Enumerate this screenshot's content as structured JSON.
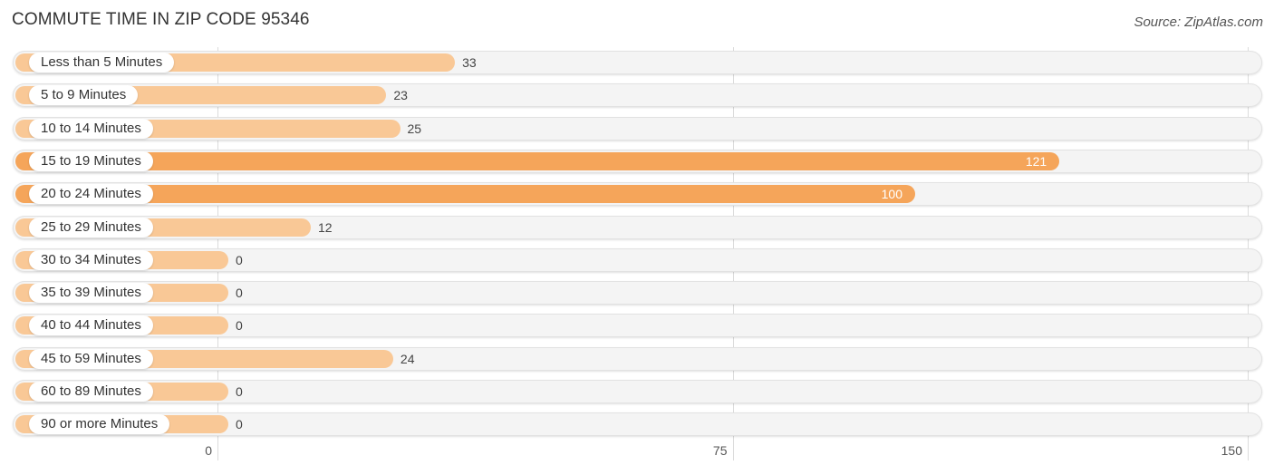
{
  "chart_data": {
    "type": "bar",
    "orientation": "horizontal",
    "title": "COMMUTE TIME IN ZIP CODE 95346",
    "source": "Source: ZipAtlas.com",
    "categories": [
      "Less than 5 Minutes",
      "5 to 9 Minutes",
      "10 to 14 Minutes",
      "15 to 19 Minutes",
      "20 to 24 Minutes",
      "25 to 29 Minutes",
      "30 to 34 Minutes",
      "35 to 39 Minutes",
      "40 to 44 Minutes",
      "45 to 59 Minutes",
      "60 to 89 Minutes",
      "90 or more Minutes"
    ],
    "values": [
      33,
      23,
      25,
      121,
      100,
      12,
      0,
      0,
      0,
      24,
      0,
      0
    ],
    "xlabel": "",
    "ylabel": "",
    "xlim": [
      0,
      150
    ],
    "xticks": [
      0,
      75,
      150
    ],
    "grid": true,
    "colors": {
      "normal": "#f9c896",
      "highlight": "#f5a55a"
    }
  }
}
